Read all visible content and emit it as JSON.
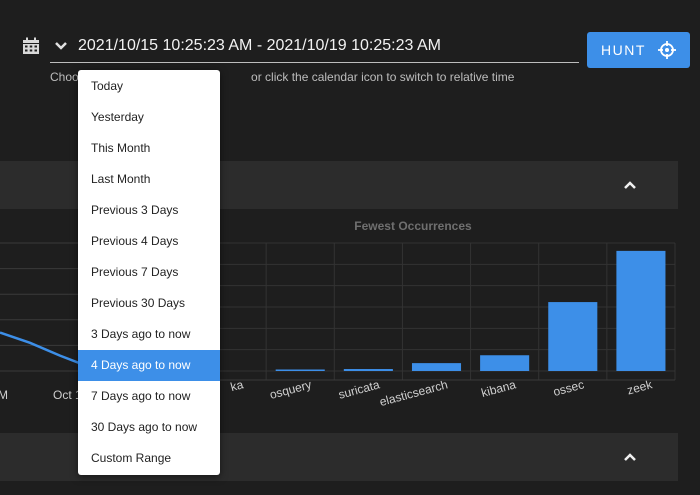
{
  "date_range": {
    "value": "2021/10/15 10:25:23 AM - 2021/10/19 10:25:23 AM",
    "hint": "Choose a date range or click the calendar icon to switch to relative time",
    "hint_visible_left": "Choo",
    "hint_visible_right": " or click the calendar icon to switch to relative time"
  },
  "hunt_button": {
    "label": "HUNT",
    "icon": "crosshair-icon"
  },
  "dropdown": {
    "items": [
      "Today",
      "Yesterday",
      "This Month",
      "Last Month",
      "Previous 3 Days",
      "Previous 4 Days",
      "Previous 7 Days",
      "Previous 30 Days",
      "3 Days ago to now",
      "4 Days ago to now",
      "7 Days ago to now",
      "30 Days ago to now",
      "Custom Range"
    ],
    "selected_index": 9
  },
  "colors": {
    "accent": "#3d8fe8",
    "panel": "#2c2c2c",
    "background": "#1e1e1e"
  },
  "chart_data": [
    {
      "type": "line",
      "x_tick_labels": [
        "M",
        "Oct 1"
      ],
      "series": [
        {
          "values": [
            3.0,
            2.2,
            1.2,
            0.3
          ]
        }
      ]
    },
    {
      "type": "bar",
      "title": "Fewest Occurrences",
      "categories": [
        "ka",
        "osquery",
        "suricata",
        "elasticsearch",
        "kibana",
        "ossec",
        "zeek"
      ],
      "values": [
        0,
        1,
        2,
        8,
        16,
        70,
        122
      ],
      "ylim": [
        0,
        130
      ],
      "grid": true
    }
  ]
}
